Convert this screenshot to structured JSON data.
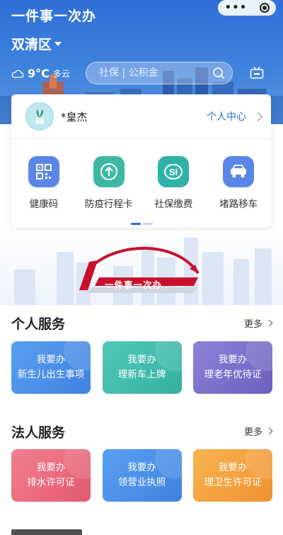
{
  "header": {
    "app_title": "一件事一次办",
    "district": "双清区",
    "weather": {
      "temperature": "9°C",
      "condition": "多云"
    },
    "search": {
      "placeholder": "社保 | 公积金"
    }
  },
  "user": {
    "name": "*皇杰",
    "center_label": "个人中心"
  },
  "quick_access": [
    {
      "label": "健康码",
      "icon": "qr-code-icon",
      "color": "#5a86e8"
    },
    {
      "label": "防疫行程卡",
      "icon": "arrow-up-circle-icon",
      "color": "#3fb8a2"
    },
    {
      "label": "社保缴费",
      "icon": "social-security-icon",
      "color": "#2fb2a6"
    },
    {
      "label": "堵路移车",
      "icon": "car-icon",
      "color": "#5a86e8"
    }
  ],
  "banner": {
    "slogan": "一件事一次办"
  },
  "personal_services": {
    "title": "个人服务",
    "more": "更多",
    "items": [
      {
        "line1": "我要办",
        "line2": "新生儿出生事项",
        "color": "#4a8ee8"
      },
      {
        "line1": "我要办",
        "line2": "理新车上牌",
        "color": "#3fbaa8"
      },
      {
        "line1": "我要办",
        "line2": "理老年优待证",
        "color": "#7a6fc8"
      }
    ]
  },
  "legal_services": {
    "title": "法人服务",
    "more": "更多",
    "items": [
      {
        "line1": "我要办",
        "line2": "排水许可证",
        "color": "#ec6a7e"
      },
      {
        "line1": "我要办",
        "line2": "领营业执照",
        "color": "#4a8ee8"
      },
      {
        "line1": "我要办",
        "line2": "理卫生许可证",
        "color": "#f4a040"
      }
    ]
  },
  "colors": {
    "primary": "#2f6fd6",
    "indicator_active": "#2f6fd6",
    "indicator_inactive": "#c7d5ee"
  }
}
